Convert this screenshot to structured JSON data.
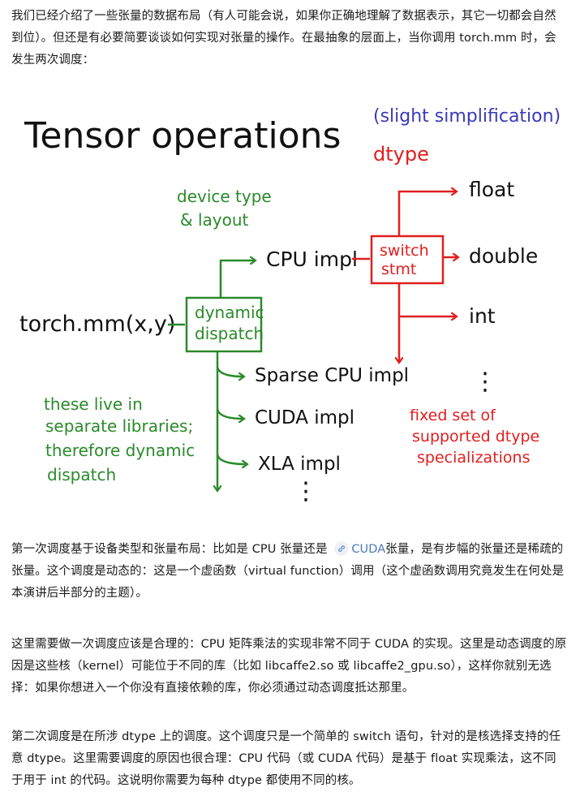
{
  "article": {
    "p1": "我们已经介绍了一些张量的数据布局（有人可能会说，如果你正确地理解了数据表示，其它一切都会自然到位）。但还是有必要简要谈谈如何实现对张量的操作。在最抽象的层面上，当你调用 torch.mm 时，会发生两次调度：",
    "p2_before": "第一次调度基于设备类型和张量布局：比如是 CPU 张量还是 ",
    "p2_link": "CUDA",
    "p2_after": "张量，是有步幅的张量还是稀疏的张量。这个调度是动态的：这是一个虚函数（virtual function）调用（这个虚函数调用究竟发生在何处是本演讲后半部分的主题）。",
    "p3": "这里需要做一次调度应该是合理的：CPU 矩阵乘法的实现非常不同于 CUDA 的实现。这里是动态调度的原因是这些核（kernel）可能位于不同的库（比如 libcaffe2.so 或 libcaffe2_gpu.so），这样你就别无选择：如果你想进入一个你没有直接依赖的库，你必须通过动态调度抵达那里。",
    "p4": "第二次调度是在所涉 dtype 上的调度。这个调度只是一个简单的 switch 语句，针对的是核选择支持的任意 dtype。这里需要调度的原因也很合理：CPU 代码（或 CUDA 代码）是基于 float 实现乘法，这不同于用于 int 的代码。这说明你需要为每种 dtype 都使用不同的核。"
  },
  "diagram": {
    "title": "Tensor operations",
    "simplification": "(slight simplification)",
    "dtype_label": "dtype",
    "device_note": [
      "device type",
      "& layout"
    ],
    "entry": "torch.mm(x,y)",
    "dispatch_box": [
      "dynamic",
      "dispatch"
    ],
    "cpu_impl": "CPU impl",
    "switch_box": [
      "switch",
      "stmt"
    ],
    "dtypes": [
      "float",
      "double",
      "int"
    ],
    "ellipsis": "⋮",
    "impls": [
      "Sparse CPU impl",
      "CUDA impl",
      "XLA impl"
    ],
    "libraries_note": [
      "these live in",
      "separate libraries;",
      "therefore dynamic",
      "dispatch"
    ],
    "fixed_note": [
      "fixed set of",
      "supported dtype",
      "specializations"
    ],
    "colors": {
      "ink": "#111111",
      "green": "#2a8a2a",
      "red": "#e01f1f",
      "blue": "#3a3ab8",
      "link": "#4a7ab8"
    }
  }
}
